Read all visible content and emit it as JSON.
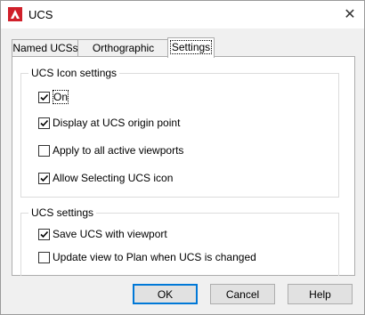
{
  "window": {
    "title": "UCS",
    "close_symbol": "✕"
  },
  "tabs": [
    {
      "label": "Named UCSs",
      "active": false
    },
    {
      "label": "Orthographic UCSs",
      "active": false
    },
    {
      "label": "Settings",
      "active": true
    }
  ],
  "icon_settings": {
    "title": "UCS Icon settings",
    "items": [
      {
        "label": "On",
        "checked": true
      },
      {
        "label": "Display at UCS origin point",
        "checked": true
      },
      {
        "label": "Apply to all active viewports",
        "checked": false
      },
      {
        "label": "Allow Selecting UCS icon",
        "checked": true
      }
    ]
  },
  "ucs_settings": {
    "title": "UCS settings",
    "items": [
      {
        "label": "Save UCS with viewport",
        "checked": true
      },
      {
        "label": "Update view to Plan when UCS is changed",
        "checked": false
      }
    ]
  },
  "buttons": {
    "ok": "OK",
    "cancel": "Cancel",
    "help": "Help"
  },
  "colors": {
    "accent": "#0078d7",
    "app_icon": "#d0202a"
  }
}
